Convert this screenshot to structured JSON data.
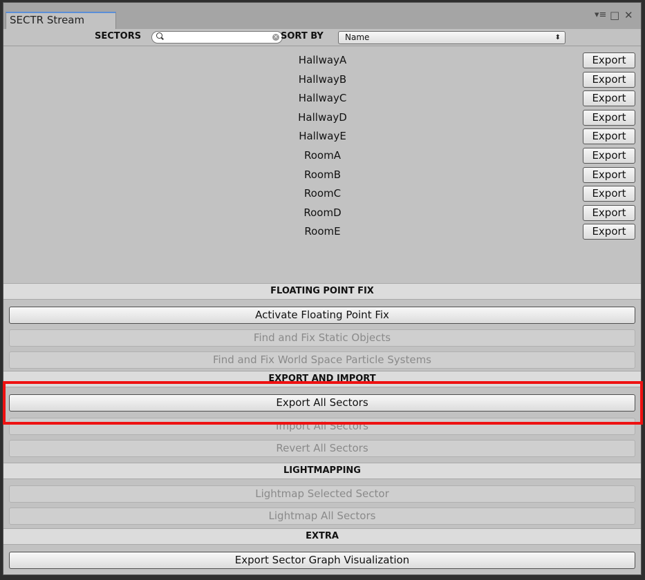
{
  "window": {
    "tab_title": "SECTR Stream",
    "controls": {
      "menu_glyph": "▾≡",
      "maximize_glyph": "□",
      "close_glyph": "✕"
    }
  },
  "toolbar": {
    "sectors_label": "SECTORS",
    "search_placeholder": "",
    "sort_label": "SORT BY",
    "sort_value": "Name",
    "sort_arrow": "⬍"
  },
  "sectors": [
    {
      "name": "HallwayA",
      "export_label": "Export"
    },
    {
      "name": "HallwayB",
      "export_label": "Export"
    },
    {
      "name": "HallwayC",
      "export_label": "Export"
    },
    {
      "name": "HallwayD",
      "export_label": "Export"
    },
    {
      "name": "HallwayE",
      "export_label": "Export"
    },
    {
      "name": "RoomA",
      "export_label": "Export"
    },
    {
      "name": "RoomB",
      "export_label": "Export"
    },
    {
      "name": "RoomC",
      "export_label": "Export"
    },
    {
      "name": "RoomD",
      "export_label": "Export"
    },
    {
      "name": "RoomE",
      "export_label": "Export"
    }
  ],
  "floating_point_fix": {
    "header": "FLOATING POINT FIX",
    "activate": "Activate Floating Point Fix",
    "fix_static": "Find and Fix Static Objects",
    "fix_particles": "Find and Fix World Space Particle Systems"
  },
  "export_import": {
    "header": "EXPORT AND IMPORT",
    "export_all": "Export All Sectors",
    "import_all": "Import All Sectors",
    "revert_all": "Revert All Sectors"
  },
  "lightmapping": {
    "header": "LIGHTMAPPING",
    "selected": "Lightmap Selected Sector",
    "all": "Lightmap All Sectors"
  },
  "extra": {
    "header": "EXTRA",
    "export_graph": "Export Sector Graph Visualization"
  },
  "colors": {
    "highlight": "#ee1111",
    "panel": "#c2c2c2",
    "tab_accent": "#5a8fd8",
    "disabled_text": "#8a8a8a"
  }
}
